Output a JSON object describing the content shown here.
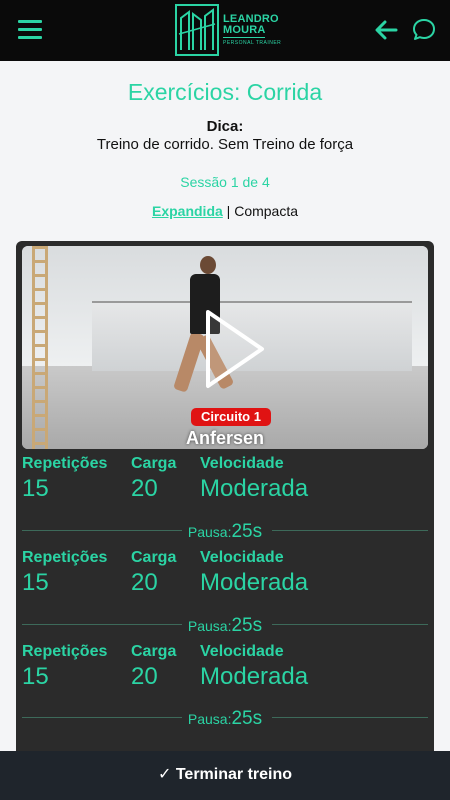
{
  "header": {
    "logo_name_line1": "LEANDRO",
    "logo_name_line2": "MOURA",
    "logo_subtitle": "PERSONAL TRAINER",
    "icons": {
      "menu": "hamburger-menu-icon",
      "back": "arrow-left-icon",
      "chat": "chat-bubble-icon"
    }
  },
  "page": {
    "title": "Exercícios: Corrida",
    "tip_label": "Dica:",
    "tip_text": "Treino de corrido. Sem Treino de força",
    "session": "Sessão 1 de 4",
    "view_expanded": "Expandida",
    "view_separator": " | ",
    "view_compact": "Compacta"
  },
  "exercise": {
    "circuit": "Circuito 1",
    "name": "Anfersen",
    "sets": [
      {
        "reps_label": "Repetições",
        "reps": "15",
        "load_label": "Carga",
        "load": "20",
        "speed_label": "Velocidade",
        "speed": "Moderada",
        "pause_label": "Pausa:",
        "pause": "25s"
      },
      {
        "reps_label": "Repetições",
        "reps": "15",
        "load_label": "Carga",
        "load": "20",
        "speed_label": "Velocidade",
        "speed": "Moderada",
        "pause_label": "Pausa:",
        "pause": "25s"
      },
      {
        "reps_label": "Repetições",
        "reps": "15",
        "load_label": "Carga",
        "load": "20",
        "speed_label": "Velocidade",
        "speed": "Moderada",
        "pause_label": "Pausa:",
        "pause": "25s"
      }
    ]
  },
  "footer": {
    "finish_label": "✓ Terminar treino"
  },
  "colors": {
    "accent": "#2bd4a4",
    "topbar": "#0a0a0a",
    "card": "#2b2b2b",
    "badge": "#e01313",
    "footer": "#1f252c"
  }
}
